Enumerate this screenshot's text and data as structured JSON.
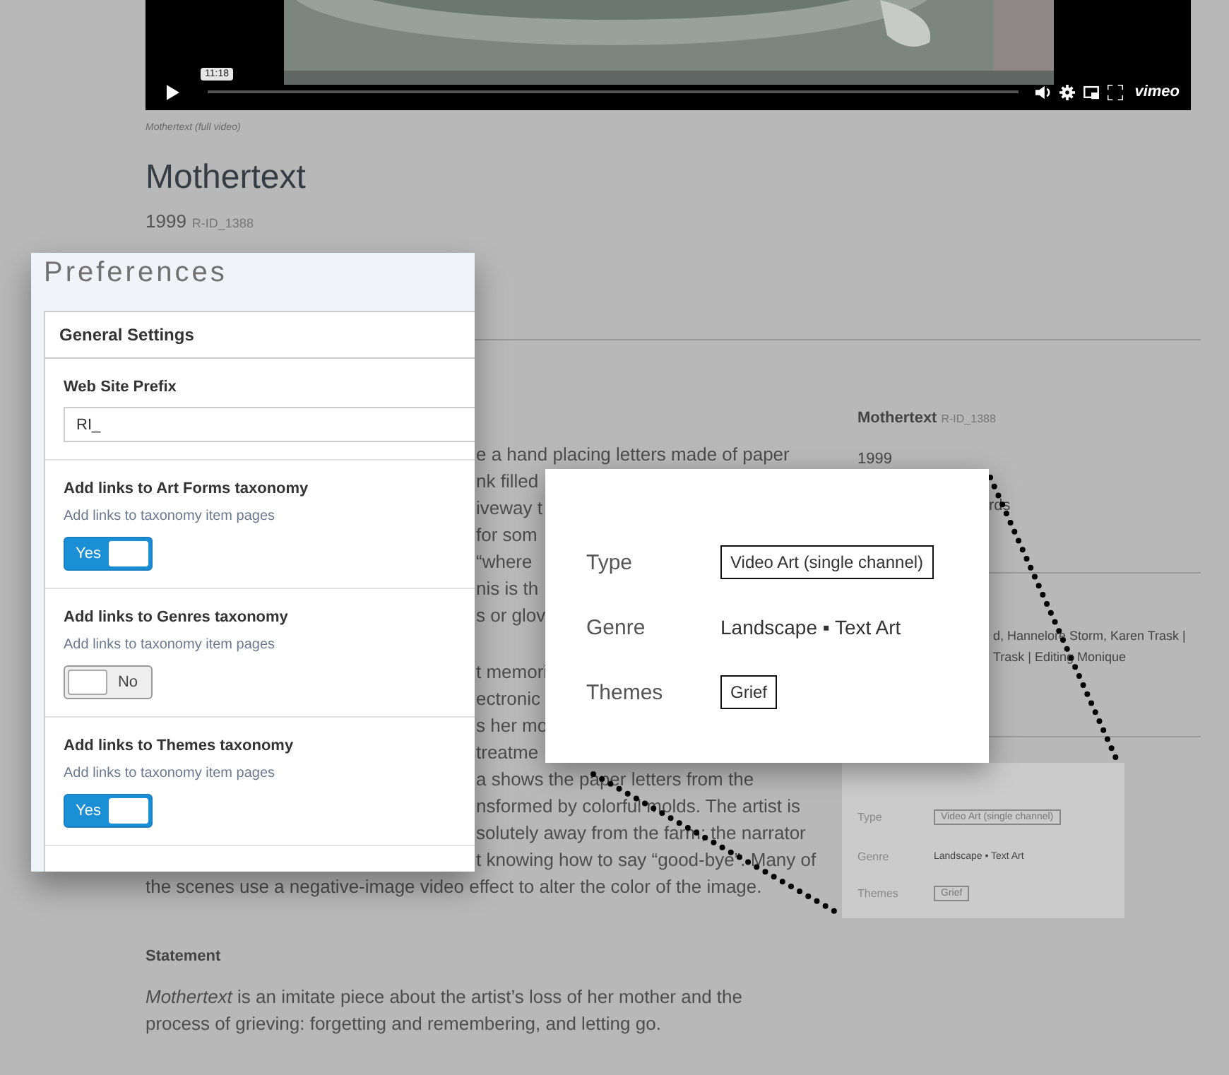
{
  "video": {
    "timestamp": "11:18",
    "brand": "vimeo",
    "caption": "Mothertext (full video)"
  },
  "title": "Mothertext",
  "year": "1999",
  "record_id": "R-ID_1388",
  "description": {
    "paragraph_1": [
      "e a hand placing letters made of paper",
      "nk filled",
      "iveway t",
      "for som",
      "“where",
      "nis is th",
      "s or glov"
    ],
    "paragraph_2": [
      "t memori",
      "ectronic",
      "s her mo",
      "treatme",
      "a shows the paper letters from the",
      "nsformed by colorful molds. The artist is",
      "solutely away from the farm; the narrator",
      "t knowing how to say “good-bye”. Many of"
    ],
    "last_line": "the scenes use a negative-image video effect to alter the color of the image."
  },
  "statement": {
    "heading": "Statement",
    "text": "*Mothertext* is an imitate piece about the artist’s loss of her mother and the process of grieving: forgetting and remembering, and letting go."
  },
  "sidebar": {
    "title": "Mothertext",
    "record_id": "R-ID_1388",
    "year": "1999",
    "fragment": "rds",
    "credits": [
      "d, Hannelore Storm, Karen Trask |",
      "Trask | Editing Monique"
    ]
  },
  "preferences": {
    "title": "Preferences",
    "card_title": "General Settings",
    "prefix_label": "Web Site Prefix",
    "prefix_value": "RI_",
    "toggles": [
      {
        "label": "Add links to Art Forms taxonomy",
        "hint": "Add links to taxonomy item pages",
        "on": true,
        "text": "Yes"
      },
      {
        "label": "Add links to Genres taxonomy",
        "hint": "Add links to taxonomy item pages",
        "on": false,
        "text": "No"
      },
      {
        "label": "Add links to Themes taxonomy",
        "hint": "Add links to taxonomy item pages",
        "on": true,
        "text": "Yes"
      }
    ]
  },
  "callout": {
    "rows": [
      {
        "label": "Type",
        "kind": "tag",
        "value": "Video Art (single channel)"
      },
      {
        "label": "Genre",
        "kind": "text",
        "value": "Landscape ▪ Text Art"
      },
      {
        "label": "Themes",
        "kind": "tag",
        "value": "Grief"
      }
    ]
  },
  "callout_source": {
    "rows": [
      {
        "label": "Type",
        "kind": "tag",
        "value": "Video Art (single channel)"
      },
      {
        "label": "Genre",
        "kind": "text",
        "value": "Landscape ▪ Text Art"
      },
      {
        "label": "Themes",
        "kind": "tag",
        "value": "Grief"
      }
    ]
  }
}
